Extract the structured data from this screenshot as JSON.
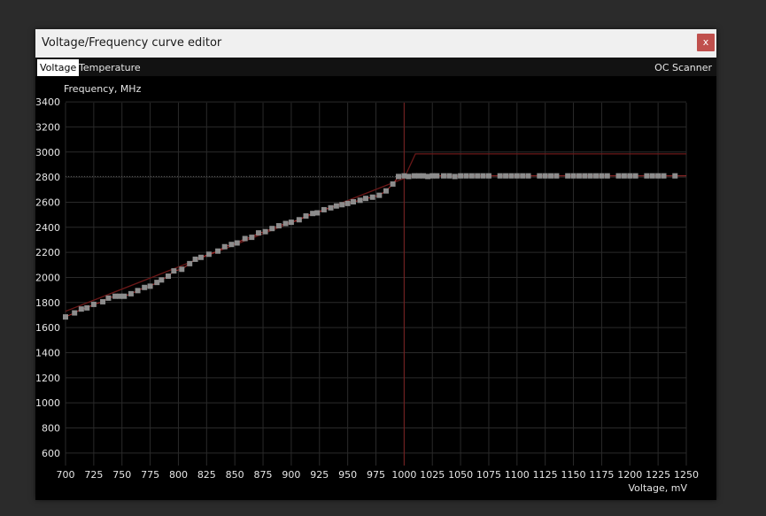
{
  "window": {
    "title": "Voltage/Frequency curve editor",
    "close_label": "x"
  },
  "tabs": [
    {
      "label": "Voltage",
      "active": true
    },
    {
      "label": "Temperature",
      "active": false
    }
  ],
  "oc_scanner_label": "OC Scanner",
  "colors": {
    "point": "#8c8c8c",
    "curve": "#b03030",
    "grid": "#2a2a2a",
    "close": "#c0504d"
  },
  "chart_data": {
    "type": "scatter",
    "ylabel": "Frequency, MHz",
    "xlabel": "Voltage, mV",
    "xlim": [
      700,
      1250
    ],
    "ylim": [
      500,
      3450
    ],
    "xticks": [
      700,
      725,
      750,
      775,
      800,
      825,
      850,
      875,
      900,
      925,
      950,
      975,
      1000,
      1025,
      1050,
      1075,
      1100,
      1125,
      1150,
      1175,
      1200,
      1225,
      1250
    ],
    "yticks": [
      600,
      800,
      1000,
      1200,
      1400,
      1600,
      1800,
      2000,
      2200,
      2400,
      2600,
      2800,
      3000,
      3200,
      3400
    ],
    "current_voltage": 1000,
    "current_frequency": 2805,
    "upper_curve": {
      "x": [
        700,
        1000,
        1010,
        1250
      ],
      "y": [
        1730,
        2790,
        2985,
        2985
      ]
    },
    "series": [
      {
        "x": [
          700,
          708,
          714,
          719,
          725,
          733,
          738,
          744,
          748,
          752,
          758,
          764,
          770,
          775,
          781,
          785,
          791,
          796,
          803,
          810,
          815,
          820,
          827,
          835,
          841,
          847,
          852,
          859,
          865,
          871,
          877,
          883,
          889,
          895,
          900,
          907,
          913,
          919,
          923,
          929,
          935,
          940,
          945,
          950,
          955,
          961,
          966,
          972,
          978,
          984,
          990,
          995,
          1000,
          1004,
          1009,
          1013,
          1017,
          1021,
          1025,
          1029,
          1035,
          1040,
          1045,
          1050,
          1055,
          1060,
          1065,
          1070,
          1075,
          1085,
          1090,
          1095,
          1100,
          1105,
          1110,
          1120,
          1125,
          1130,
          1135,
          1145,
          1150,
          1155,
          1160,
          1165,
          1170,
          1175,
          1180,
          1190,
          1195,
          1200,
          1205,
          1215,
          1220,
          1225,
          1230,
          1240
        ],
        "y": [
          1685,
          1717,
          1748,
          1757,
          1785,
          1806,
          1835,
          1850,
          1850,
          1850,
          1870,
          1895,
          1920,
          1930,
          1960,
          1980,
          2010,
          2052,
          2065,
          2110,
          2145,
          2160,
          2185,
          2210,
          2245,
          2263,
          2275,
          2310,
          2320,
          2355,
          2365,
          2390,
          2412,
          2430,
          2440,
          2460,
          2490,
          2510,
          2515,
          2540,
          2555,
          2570,
          2580,
          2590,
          2603,
          2615,
          2630,
          2640,
          2655,
          2690,
          2745,
          2805,
          2810,
          2805,
          2810,
          2810,
          2810,
          2805,
          2810,
          2810,
          2810,
          2810,
          2805,
          2810,
          2810,
          2810,
          2810,
          2810,
          2810,
          2810,
          2810,
          2810,
          2810,
          2810,
          2810,
          2810,
          2810,
          2810,
          2810,
          2810,
          2810,
          2810,
          2810,
          2810,
          2810,
          2810,
          2810,
          2810,
          2810,
          2810,
          2810,
          2810,
          2810,
          2810,
          2810,
          2810
        ]
      }
    ]
  }
}
